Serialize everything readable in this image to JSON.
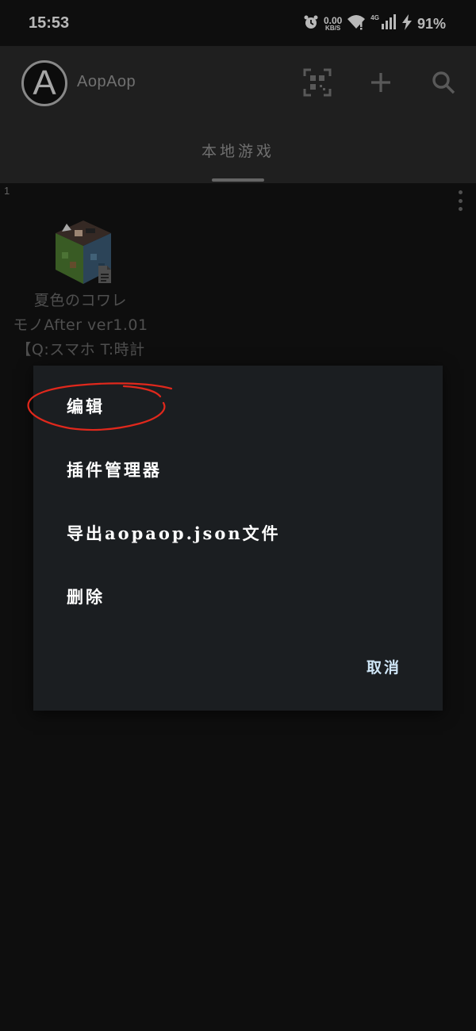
{
  "status_bar": {
    "time": "15:53",
    "net_speed_value": "0.00",
    "net_speed_unit": "KB/S",
    "network_type": "4G",
    "battery_percent": "91%",
    "icons": [
      "alarm-icon",
      "wifi-icon",
      "signal-icon",
      "charging-icon"
    ]
  },
  "app_bar": {
    "avatar_letter": "A",
    "title": "AopAop",
    "icons": [
      "qr-scan-icon",
      "add-icon",
      "search-icon"
    ]
  },
  "tabs": [
    {
      "label": "本地游戏",
      "selected": true
    }
  ],
  "list": {
    "count": "1",
    "items": [
      {
        "title_lines": [
          "夏色のコワレ",
          "モノAfter ver1.01",
          "【Q:スマホ T:時計"
        ]
      }
    ]
  },
  "dialog": {
    "items": [
      {
        "label": "编辑"
      },
      {
        "label": "插件管理器"
      },
      {
        "label": "导出aopaop.json文件"
      },
      {
        "label": "删除"
      }
    ],
    "cancel_label": "取消"
  },
  "colors": {
    "background": "#141414",
    "app_bar": "#2c2c2c",
    "dialog": "#1b1e21",
    "annotation": "#e0281c",
    "cancel_text": "#cfe6f7"
  }
}
